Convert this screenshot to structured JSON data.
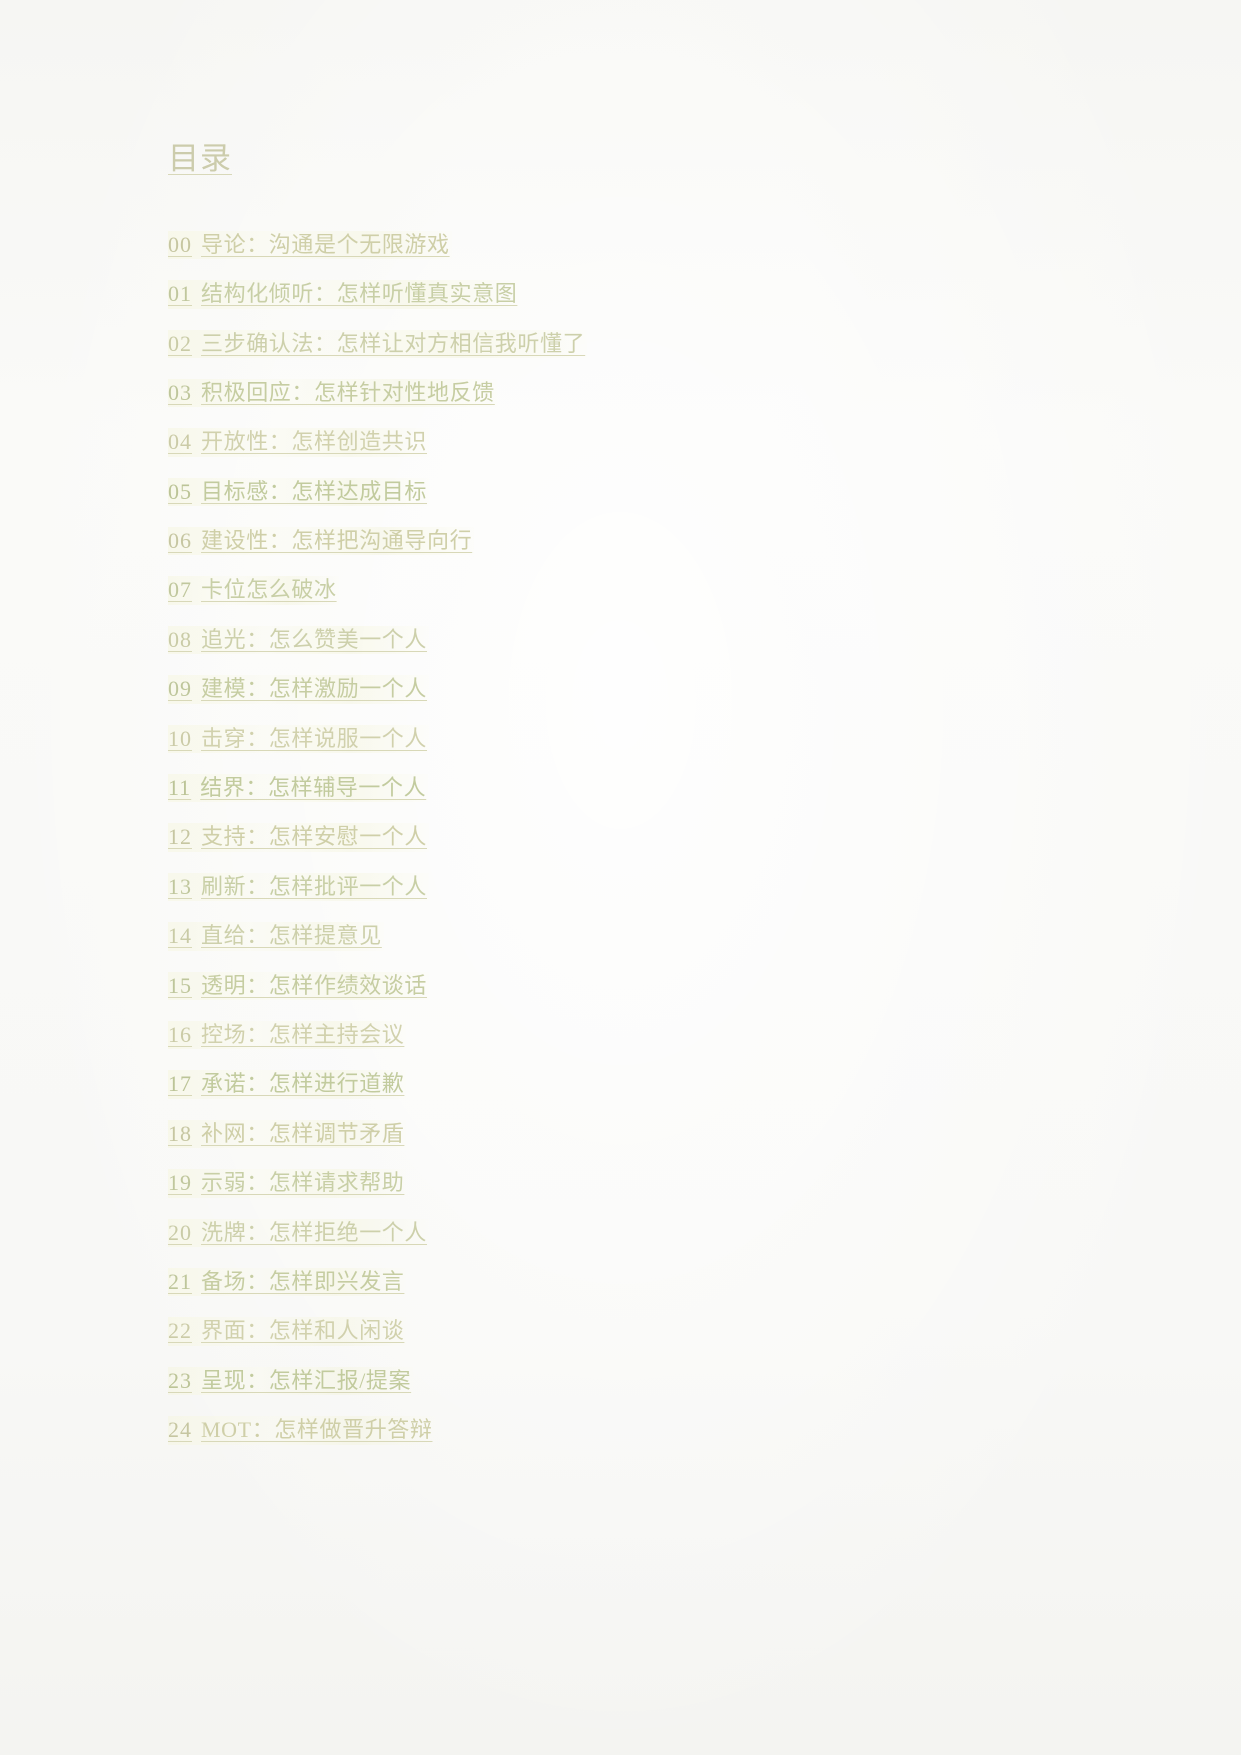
{
  "document": {
    "title": "目录",
    "background_color": "#f8f8f6",
    "ink_color": "#cfcfa9"
  },
  "toc": {
    "items": [
      {
        "num": "00",
        "text": "导论：沟通是个无限游戏"
      },
      {
        "num": "01",
        "text": "结构化倾听：怎样听懂真实意图"
      },
      {
        "num": "02",
        "text": "三步确认法：怎样让对方相信我听懂了"
      },
      {
        "num": "03",
        "text": "积极回应：怎样针对性地反馈"
      },
      {
        "num": "04",
        "text": "开放性：怎样创造共识"
      },
      {
        "num": "05",
        "text": "目标感：怎样达成目标"
      },
      {
        "num": "06",
        "text": "建设性：怎样把沟通导向行"
      },
      {
        "num": "07",
        "text": "卡位怎么破冰"
      },
      {
        "num": "08",
        "text": "追光：怎么赞美一个人"
      },
      {
        "num": "09",
        "text": "建模：怎样激励一个人"
      },
      {
        "num": "10",
        "text": "击穿：怎样说服一个人"
      },
      {
        "num": "11",
        "text": "结界：怎样辅导一个人"
      },
      {
        "num": "12",
        "text": "支持：怎样安慰一个人"
      },
      {
        "num": "13",
        "text": "刷新：怎样批评一个人"
      },
      {
        "num": "14",
        "text": "直给：怎样提意见"
      },
      {
        "num": "15",
        "text": "透明：怎样作绩效谈话"
      },
      {
        "num": "16",
        "text": "控场：怎样主持会议"
      },
      {
        "num": "17",
        "text": "承诺：怎样进行道歉"
      },
      {
        "num": "18",
        "text": "补网：怎样调节矛盾"
      },
      {
        "num": "19",
        "text": "示弱：怎样请求帮助"
      },
      {
        "num": "20",
        "text": "洗牌：怎样拒绝一个人"
      },
      {
        "num": "21",
        "text": "备场：怎样即兴发言"
      },
      {
        "num": "22",
        "text": "界面：怎样和人闲谈"
      },
      {
        "num": "23",
        "text": "呈现：怎样汇报/提案"
      },
      {
        "num": "24",
        "text": "MOT：怎样做晋升答辩"
      }
    ]
  }
}
